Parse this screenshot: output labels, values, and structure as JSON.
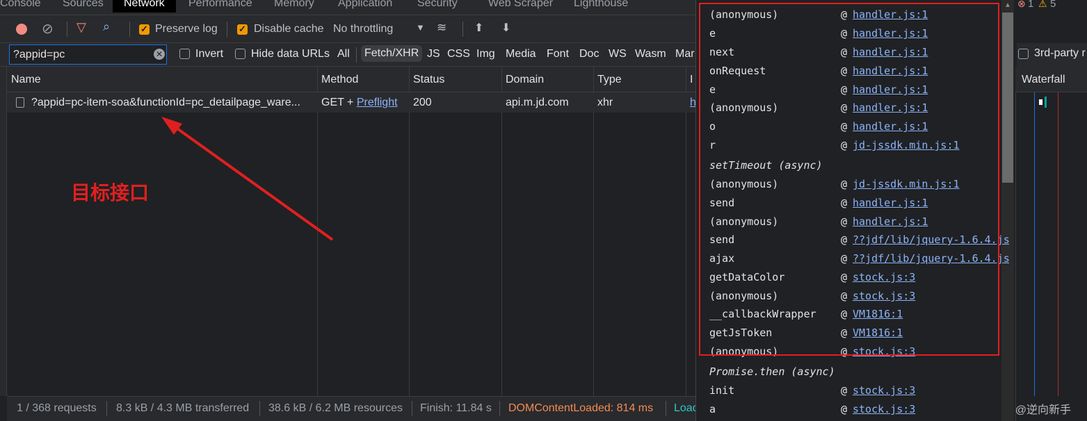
{
  "tabs": [
    "Console",
    "Sources",
    "Network",
    "Performance",
    "Memory",
    "Application",
    "Security",
    "Web Scraper",
    "Lighthouse"
  ],
  "toolbar": {
    "preserve_log": "Preserve log",
    "disable_cache": "Disable cache",
    "throttling": "No throttling"
  },
  "filter": {
    "value": "?appid=pc",
    "invert": "Invert",
    "hide_data_urls": "Hide data URLs",
    "types": [
      "All",
      "Fetch/XHR",
      "JS",
      "CSS",
      "Img",
      "Media",
      "Font",
      "Doc",
      "WS",
      "Wasm",
      "Mar"
    ],
    "third_party": "3rd-party r"
  },
  "table": {
    "headers": [
      "Name",
      "Method",
      "Status",
      "Domain",
      "Type",
      "I"
    ],
    "waterfall": "Waterfall",
    "rows": [
      {
        "name": "?appid=pc-item-soa&functionId=pc_detailpage_ware...",
        "method": "GET + ",
        "preflight": "Preflight",
        "status": "200",
        "domain": "api.m.jd.com",
        "type": "xhr",
        "initiator": "h"
      }
    ]
  },
  "annotation": "目标接口",
  "status": {
    "requests": "1 / 368 requests",
    "transferred": "8.3 kB / 4.3 MB transferred",
    "resources": "38.6 kB / 6.2 MB resources",
    "finish": "Finish: 11.84 s",
    "dcl": "DOMContentLoaded: 814 ms",
    "load": "Load"
  },
  "badges": {
    "errors": "1",
    "warnings": "5"
  },
  "stack": [
    {
      "fn": "(anonymous)",
      "src": "handler.js:1"
    },
    {
      "fn": "e",
      "src": "handler.js:1"
    },
    {
      "fn": "next",
      "src": "handler.js:1"
    },
    {
      "fn": "onRequest",
      "src": "handler.js:1"
    },
    {
      "fn": "e",
      "src": "handler.js:1"
    },
    {
      "fn": "(anonymous)",
      "src": "handler.js:1"
    },
    {
      "fn": "o",
      "src": "handler.js:1"
    },
    {
      "fn": "r",
      "src": "jd-jssdk.min.js:1"
    },
    {
      "async": "setTimeout (async)"
    },
    {
      "fn": "(anonymous)",
      "src": "jd-jssdk.min.js:1"
    },
    {
      "fn": "send",
      "src": "handler.js:1"
    },
    {
      "fn": "(anonymous)",
      "src": "handler.js:1"
    },
    {
      "fn": "send",
      "src": "??jdf/lib/jquery-1.6.4.js"
    },
    {
      "fn": "ajax",
      "src": "??jdf/lib/jquery-1.6.4.js"
    },
    {
      "fn": "getDataColor",
      "src": "stock.js:3"
    },
    {
      "fn": "(anonymous)",
      "src": "stock.js:3"
    },
    {
      "fn": "__callbackWrapper",
      "src": "VM1816:1"
    },
    {
      "fn": "getJsToken",
      "src": "VM1816:1"
    },
    {
      "fn": "(anonymous)",
      "src": "stock.js:3"
    },
    {
      "async": "Promise.then (async)"
    },
    {
      "fn": "init",
      "src": "stock.js:3"
    },
    {
      "fn": "a",
      "src": "stock.js:3"
    }
  ],
  "watermark": "CSDN @逆向新手",
  "colors": {
    "highlight": "#e02020",
    "link": "#8ab4f8",
    "dcl": "#f28b54",
    "load": "#2fc6c6"
  }
}
